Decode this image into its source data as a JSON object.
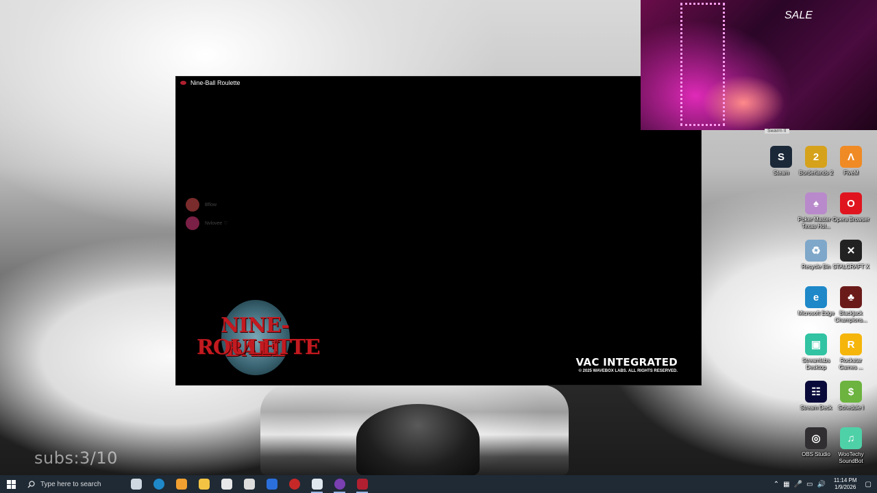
{
  "game_window": {
    "title": "Nine-Ball Roulette",
    "players": [
      {
        "name": "Bflow",
        "avatar_color": "#7a2b2b"
      },
      {
        "name": "Nvlovee ♡",
        "avatar_color": "#7a1f45"
      }
    ],
    "logo_line1": "NINE-BALL",
    "logo_line2": "ROULETTE",
    "vac_title": "VAC INTEGRATED",
    "vac_copyright": "© 2025 WAVEBOX LABS. ALL RIGHTS RESERVED."
  },
  "overlay": {
    "subs_text": "subs:3/10",
    "webcam_sign": "SALE",
    "webcam_caption": "Swarm II"
  },
  "desktop_icons": [
    {
      "label": "Steam",
      "icon": "steam-icon",
      "color": "#1b2838",
      "glyph": "S"
    },
    {
      "label": "Borderlands 2",
      "icon": "borderlands-icon",
      "color": "#d6a21c",
      "glyph": "2"
    },
    {
      "label": "FiveM",
      "icon": "fivem-icon",
      "color": "#f08a24",
      "glyph": "Λ"
    },
    {
      "label": "Poker Master - Texas Hol...",
      "icon": "poker-master-icon",
      "color": "#b98acb",
      "glyph": "♠"
    },
    {
      "label": "Opera Browser",
      "icon": "opera-icon",
      "color": "#e0141e",
      "glyph": "O"
    },
    {
      "label": "Recycle Bin",
      "icon": "recycle-bin-icon",
      "color": "#7fa7c9",
      "glyph": "♻"
    },
    {
      "label": "STALCRAFT X",
      "icon": "stalcraft-icon",
      "color": "#222222",
      "glyph": "✕"
    },
    {
      "label": "Microsoft Edge",
      "icon": "edge-icon",
      "color": "#1e88c8",
      "glyph": "e"
    },
    {
      "label": "Blackjack Champions...",
      "icon": "blackjack-icon",
      "color": "#6b1a1a",
      "glyph": "♣"
    },
    {
      "label": "Streamlabs Desktop",
      "icon": "streamlabs-icon",
      "color": "#31c3a2",
      "glyph": "▣"
    },
    {
      "label": "Rockstar Games ...",
      "icon": "rockstar-icon",
      "color": "#f5b50b",
      "glyph": "R"
    },
    {
      "label": "Stream Deck",
      "icon": "stream-deck-icon",
      "color": "#0a0a3a",
      "glyph": "☷"
    },
    {
      "label": "Schedule I",
      "icon": "schedule-icon",
      "color": "#6cb33f",
      "glyph": "$"
    },
    {
      "label": "OBS Studio",
      "icon": "obs-icon",
      "color": "#302e31",
      "glyph": "◎"
    },
    {
      "label": "WooTechy SoundBot",
      "icon": "soundbot-icon",
      "color": "#4fd1a8",
      "glyph": "♫"
    }
  ],
  "taskbar": {
    "search_placeholder": "Type here to search",
    "apps": [
      {
        "name": "task-view",
        "color": "#cfd8e0"
      },
      {
        "name": "edge",
        "color": "#1e88c8"
      },
      {
        "name": "copilot",
        "color": "#f0a030"
      },
      {
        "name": "file-explorer",
        "color": "#f3c443"
      },
      {
        "name": "calculator",
        "color": "#e8e8e8"
      },
      {
        "name": "lock-app",
        "color": "#dddddd"
      },
      {
        "name": "mail",
        "color": "#2a6fdc"
      },
      {
        "name": "xsplit",
        "color": "#c62828"
      },
      {
        "name": "steam",
        "color": "#dfe7ef"
      },
      {
        "name": "chrome",
        "color": "#7a3fb0"
      },
      {
        "name": "nine-ball-roulette",
        "color": "#b02030"
      }
    ],
    "time": "11:14 PM",
    "date": "1/9/2026"
  }
}
